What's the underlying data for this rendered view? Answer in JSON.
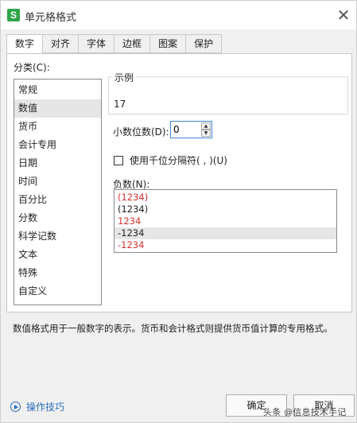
{
  "window": {
    "title": "单元格格式",
    "app_icon": "S",
    "close_glyph": "✕"
  },
  "tabs": [
    {
      "label": "数字",
      "active": true
    },
    {
      "label": "对齐"
    },
    {
      "label": "字体"
    },
    {
      "label": "边框"
    },
    {
      "label": "图案"
    },
    {
      "label": "保护"
    }
  ],
  "category": {
    "label": "分类(C):",
    "items": [
      "常规",
      "数值",
      "货币",
      "会计专用",
      "日期",
      "时间",
      "百分比",
      "分数",
      "科学记数",
      "文本",
      "特殊",
      "自定义"
    ],
    "selected": "数值"
  },
  "sample": {
    "label": "示例",
    "value": "17"
  },
  "decimal": {
    "label": "小数位数(D):",
    "value": "0"
  },
  "thousand_separator": {
    "label": "使用千位分隔符( , )(U)",
    "checked": false
  },
  "negative": {
    "label": "负数(N):",
    "items": [
      {
        "text": "(1234)",
        "color": "#d93030"
      },
      {
        "text": "(1234)",
        "color": "#222222"
      },
      {
        "text": "1234",
        "color": "#d93030"
      },
      {
        "text": "-1234",
        "color": "#222222",
        "selected": true
      },
      {
        "text": "-1234",
        "color": "#d93030"
      }
    ]
  },
  "description": "数值格式用于一般数字的表示。货币和会计格式则提供货币值计算的专用格式。",
  "footer": {
    "tips_label": "操作技巧",
    "ok_label": "确定",
    "cancel_label": "取消",
    "watermark": "头条 @信息技术手记"
  }
}
